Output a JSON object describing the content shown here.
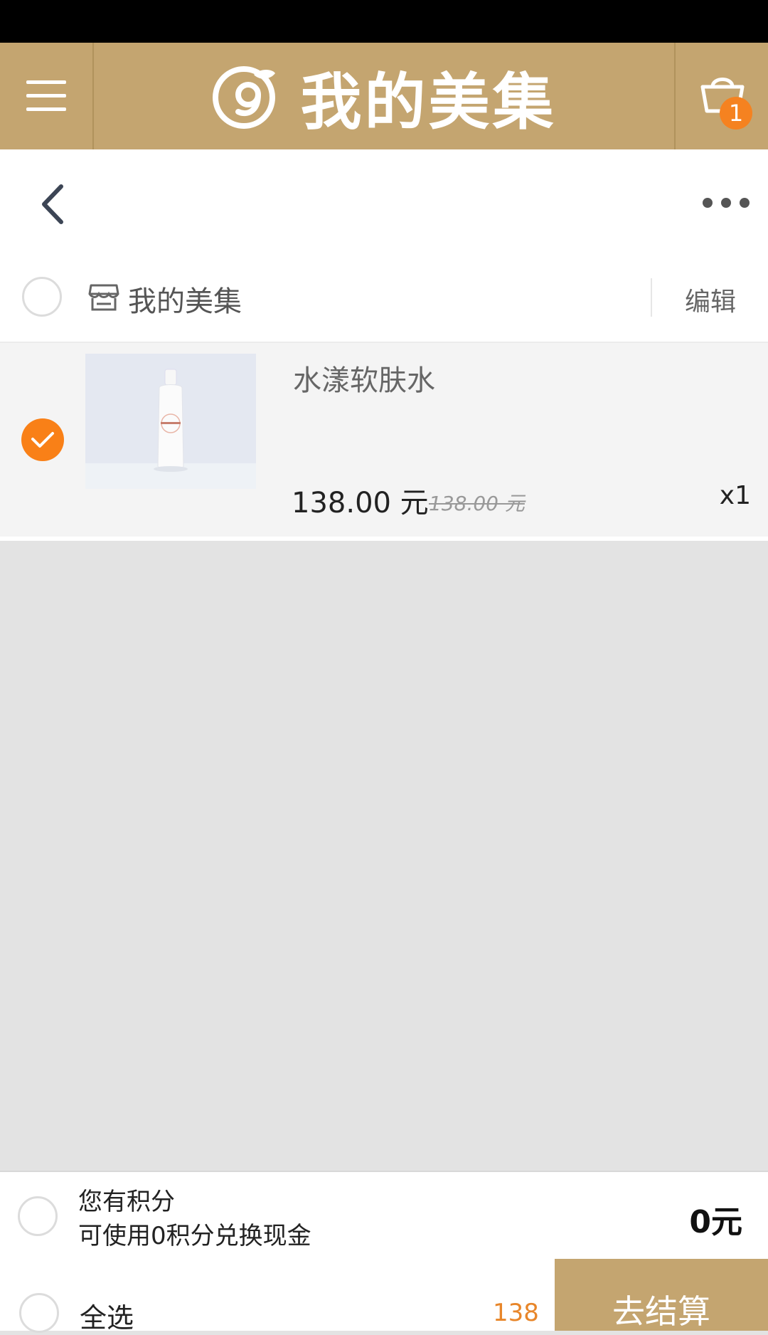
{
  "header": {
    "title": "我的美集",
    "cart_count": "1"
  },
  "shop": {
    "name": "我的美集",
    "edit_label": "编辑"
  },
  "item": {
    "name": "水漾软肤水",
    "price": "138.00 元",
    "original_price": "138.00 元",
    "quantity": "x1",
    "selected": true
  },
  "points": {
    "line1": "您有积分",
    "line2": "可使用0积分兑换现金",
    "cash_value": "0元"
  },
  "footer": {
    "select_all_label": "全选",
    "total": "138",
    "checkout_label": "去结算"
  },
  "colors": {
    "brand": "#c4a570",
    "accent": "#f98017",
    "total_text": "#e8862a"
  }
}
